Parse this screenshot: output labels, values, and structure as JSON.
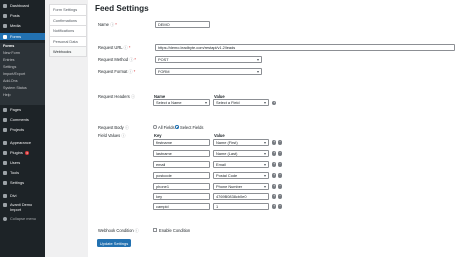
{
  "sidebar": {
    "items": [
      {
        "label": "Dashboard"
      },
      {
        "label": "Posts"
      },
      {
        "label": "Media"
      },
      {
        "label": "Forms"
      },
      {
        "label": "Pages"
      },
      {
        "label": "Comments"
      },
      {
        "label": "Projects"
      },
      {
        "label": "Appearance"
      },
      {
        "label": "Plugins",
        "badge": "3"
      },
      {
        "label": "Users"
      },
      {
        "label": "Tools"
      },
      {
        "label": "Settings"
      },
      {
        "label": "Divi"
      },
      {
        "label": "Avanti Demo Import"
      }
    ],
    "forms_submenu": [
      "Forms",
      "New Form",
      "Entries",
      "Settings",
      "Import/Export",
      "Add-Ons",
      "System Status",
      "Help"
    ],
    "collapse_label": "Collapse menu"
  },
  "subnav": {
    "items": [
      "Form Settings",
      "Confirmations",
      "Notifications",
      "Personal Data",
      "Webhooks"
    ]
  },
  "page": {
    "title": "Feed Settings"
  },
  "fields": {
    "name": {
      "label": "Name",
      "value": "DEMO"
    },
    "request_url": {
      "label": "Request URL",
      "value": "https://demo.leadbyte.com/restapi/v1.2/leads"
    },
    "request_method": {
      "label": "Request Method",
      "value": "POST"
    },
    "request_format": {
      "label": "Request Format",
      "value": "FORM"
    },
    "request_headers": {
      "label": "Request Headers",
      "name_header": "Name",
      "value_header": "Value",
      "name_select": "Select a Name",
      "value_select": "Select a Field"
    },
    "request_body": {
      "label": "Request Body",
      "option_all": "All Fields",
      "option_select": "Select Fields",
      "selected": "Select Fields"
    },
    "field_values": {
      "label": "Field Values",
      "key_header": "Key",
      "value_header": "Value",
      "rows": [
        {
          "key": "firstname",
          "value": "Name (First)"
        },
        {
          "key": "lastname",
          "value": "Name (Last)"
        },
        {
          "key": "email",
          "value": "Email"
        },
        {
          "key": "postcode",
          "value": "Postal Code"
        },
        {
          "key": "phone1",
          "value": "Phone Number"
        },
        {
          "key": "key",
          "value": "4769B0838cb0e0"
        },
        {
          "key": "campid",
          "value": "1"
        }
      ]
    },
    "webhook_condition": {
      "label": "Webhook Condition",
      "checkbox_label": "Enable Condition"
    }
  },
  "actions": {
    "update_label": "Update Settings"
  },
  "colors": {
    "accent": "#2271b1",
    "sidebar_bg": "#1d2327",
    "required": "#d63638"
  }
}
